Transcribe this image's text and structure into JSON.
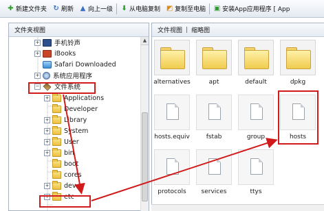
{
  "toolbar": {
    "items": [
      {
        "label": "新建文件夹",
        "icon": "plus-icon",
        "color": "#2a9d2a"
      },
      {
        "label": "刷新",
        "icon": "refresh-icon",
        "color": "#3a6fc4"
      },
      {
        "label": "向上一级",
        "icon": "up-arrow-icon",
        "color": "#3a6fc4"
      },
      {
        "label": "从电脑复制",
        "icon": "download-icon",
        "color": "#2a9d2a"
      },
      {
        "label": "复制至电脑",
        "icon": "copy-icon",
        "color": "#d98a1a"
      },
      {
        "label": "安装App应用程序 [ App",
        "icon": "install-icon",
        "color": "#2a9d2a"
      }
    ]
  },
  "left_panel": {
    "title": "文件夹视图",
    "tree": [
      {
        "label": "手机铃声",
        "icon": "ringtone-icon",
        "expander": "+"
      },
      {
        "label": "iBooks",
        "icon": "ibooks-icon",
        "expander": "+"
      },
      {
        "label": "Safari Downloaded",
        "icon": "safari-icon",
        "expander": ""
      },
      {
        "label": "系统应用程序",
        "icon": "apps-icon",
        "expander": "+"
      },
      {
        "label": "文件系统",
        "icon": "filesystem-icon",
        "expander": "−"
      },
      {
        "label": "Applications",
        "icon": "folder-icon",
        "expander": "+"
      },
      {
        "label": "Developer",
        "icon": "folder-icon",
        "expander": ""
      },
      {
        "label": "Library",
        "icon": "folder-icon",
        "expander": "+"
      },
      {
        "label": "System",
        "icon": "folder-icon",
        "expander": "+"
      },
      {
        "label": "User",
        "icon": "folder-icon",
        "expander": "+"
      },
      {
        "label": "bin",
        "icon": "folder-icon",
        "expander": "+"
      },
      {
        "label": "boot",
        "icon": "folder-icon",
        "expander": ""
      },
      {
        "label": "cores",
        "icon": "folder-icon",
        "expander": ""
      },
      {
        "label": "dev",
        "icon": "folder-icon",
        "expander": "+"
      },
      {
        "label": "etc",
        "icon": "folder-icon",
        "expander": "+"
      }
    ]
  },
  "right_panel": {
    "view_folder": "文件视图",
    "view_thumb": "缩略图",
    "items": [
      {
        "name": "alternatives",
        "type": "folder"
      },
      {
        "name": "apt",
        "type": "folder"
      },
      {
        "name": "default",
        "type": "folder"
      },
      {
        "name": "dpkg",
        "type": "folder"
      },
      {
        "name": "hosts.equiv",
        "type": "file"
      },
      {
        "name": "fstab",
        "type": "file"
      },
      {
        "name": "group",
        "type": "file"
      },
      {
        "name": "hosts",
        "type": "file"
      },
      {
        "name": "protocols",
        "type": "file"
      },
      {
        "name": "services",
        "type": "file"
      },
      {
        "name": "ttys",
        "type": "file"
      }
    ]
  },
  "colors": {
    "highlight": "#d11a1a",
    "toolbar_bg": "#e4e9f1"
  }
}
